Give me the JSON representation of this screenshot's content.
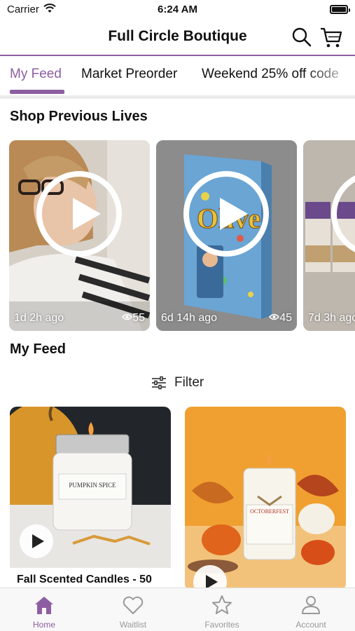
{
  "status_bar": {
    "carrier": "Carrier",
    "time": "6:24 AM"
  },
  "header": {
    "title": "Full Circle Boutique",
    "search_icon": "search-icon",
    "cart_icon": "cart-icon"
  },
  "tabs": [
    {
      "label": "My Feed",
      "active": true
    },
    {
      "label": "Market Preorder",
      "active": false
    },
    {
      "label": "Weekend 25% off code",
      "active": false
    }
  ],
  "previous_lives": {
    "title": "Shop Previous Lives",
    "items": [
      {
        "time_ago": "1d 2h ago",
        "views": "55"
      },
      {
        "time_ago": "6d 14h ago",
        "views": "45"
      },
      {
        "time_ago": "7d 3h ago",
        "views": ""
      }
    ]
  },
  "feed": {
    "title": "My Feed",
    "filter_label": "Filter",
    "items": [
      {
        "caption": "Fall Scented Candles - 50",
        "jar_label": "PUMPKIN SPICE"
      },
      {
        "caption": "",
        "jar_label": "OCTOBERFEST"
      }
    ]
  },
  "tab_bar": [
    {
      "label": "Home",
      "icon": "home-icon",
      "active": true
    },
    {
      "label": "Waitlist",
      "icon": "heart-icon",
      "active": false
    },
    {
      "label": "Favorites",
      "icon": "star-icon",
      "active": false
    },
    {
      "label": "Account",
      "icon": "person-icon",
      "active": false
    }
  ],
  "colors": {
    "accent": "#8e5ea2",
    "inactive": "#999999"
  }
}
